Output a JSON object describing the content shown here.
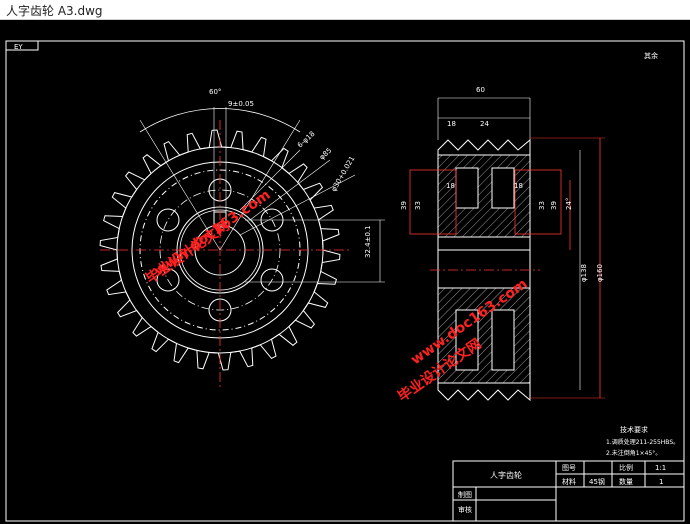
{
  "window": {
    "title": "人字齿轮 A3.dwg"
  },
  "drawing": {
    "corner_tag": "EY",
    "roughness_note": "其余",
    "front_view": {
      "angle_label": "60°",
      "keyway_label": "9±0.05",
      "holes_label": "6-φ18",
      "dia1_label": "φ85",
      "dia2_label": "φ30+0.021",
      "height_label": "32.4±0.1"
    },
    "side_view": {
      "width_label": "60",
      "left_dim": "18",
      "mid_dim": "24",
      "inner_left_label": "18",
      "inner_right_label": "18",
      "h39_left": "39",
      "h33_left": "33",
      "h33_right": "33",
      "h39_right": "39",
      "h24_right": "24°",
      "dia_small": "φ138",
      "dia_large": "φ160"
    },
    "watermarks": [
      "毕业设计论文网",
      "www.doc163.com",
      "毕业设计论文网",
      "www.doc163.com"
    ],
    "tech_req": {
      "title": "技术要求",
      "line1": "1.调质处理211-255HBS。",
      "line2": "2.未注倒角1×45°。"
    },
    "title_block": {
      "part_name": "人字齿轮",
      "drawing_no_label": "图号",
      "scale_label": "比例",
      "scale_value": "1:1",
      "material_label": "材料",
      "material_value": "45钢",
      "qty_label": "数量",
      "qty_value": "1",
      "drawn_label": "制图",
      "check_label": "审核"
    }
  }
}
